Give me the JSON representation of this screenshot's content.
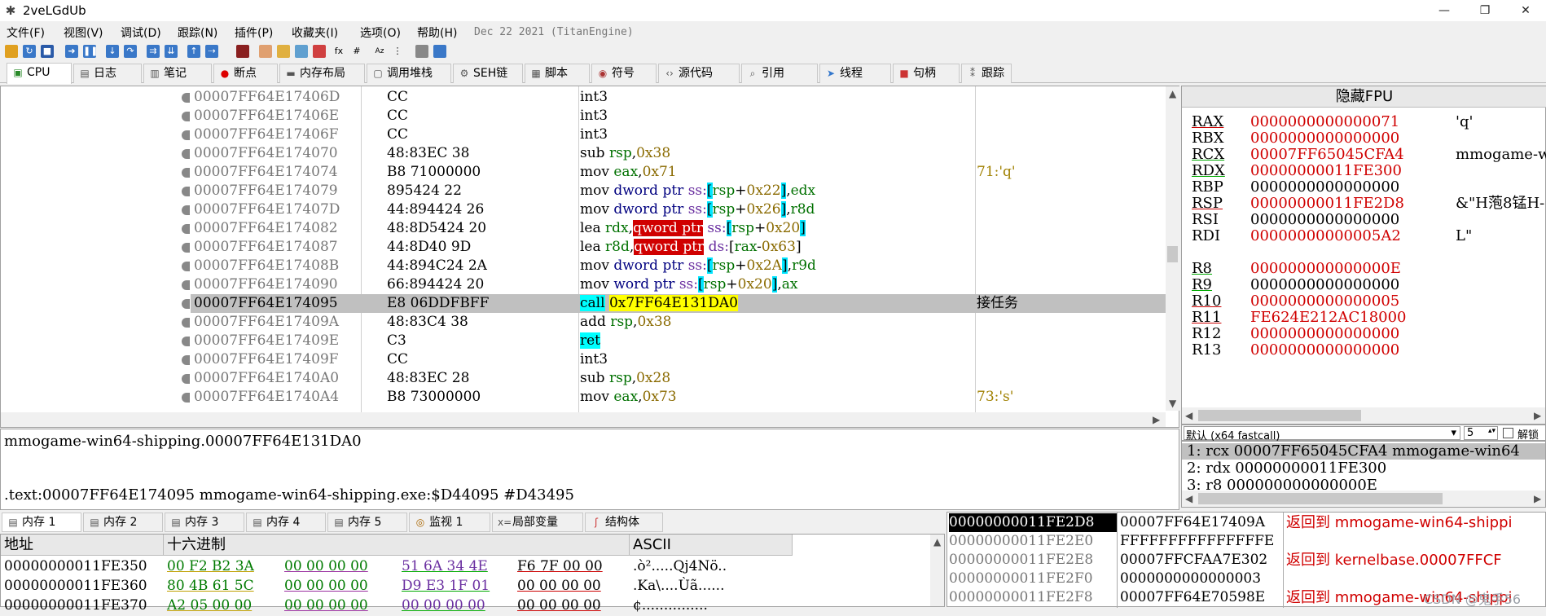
{
  "window": {
    "title": "2veLGdUb",
    "minimize": "—",
    "restore": "❐",
    "close": "✕"
  },
  "menu": [
    "文件(F)",
    "视图(V)",
    "调试(D)",
    "跟踪(N)",
    "插件(P)",
    "收藏夹(I)",
    "选项(O)",
    "帮助(H)"
  ],
  "build_date": "Dec 22 2021 (TitanEngine)",
  "tabs": [
    "CPU",
    "日志",
    "笔记",
    "断点",
    "内存布局",
    "调用堆栈",
    "SEH链",
    "脚本",
    "符号",
    "源代码",
    "引用",
    "线程",
    "句柄",
    "跟踪"
  ],
  "tab_icons": [
    "cpu-icon",
    "log-icon",
    "notes-icon",
    "breakpoint-icon",
    "memory-map-icon",
    "call-stack-icon",
    "seh-icon",
    "script-icon",
    "symbols-icon",
    "source-icon",
    "references-icon",
    "threads-icon",
    "handles-icon",
    "trace-icon"
  ],
  "disassembly": [
    {
      "addr": "00007FF64E17406D",
      "bytes": "CC",
      "asm": [
        [
          "mnem",
          "int3"
        ]
      ],
      "comment": ""
    },
    {
      "addr": "00007FF64E17406E",
      "bytes": "CC",
      "asm": [
        [
          "mnem",
          "int3"
        ]
      ],
      "comment": ""
    },
    {
      "addr": "00007FF64E17406F",
      "bytes": "CC",
      "asm": [
        [
          "mnem",
          "int3"
        ]
      ],
      "comment": ""
    },
    {
      "addr": "00007FF64E174070",
      "bytes": "48:83EC 38",
      "asm": [
        [
          "mnem",
          "sub "
        ],
        [
          "reg",
          "rsp"
        ],
        [
          "plain",
          ","
        ],
        [
          "num",
          "0x38"
        ]
      ],
      "comment": ""
    },
    {
      "addr": "00007FF64E174074",
      "bytes": "B8 71000000",
      "asm": [
        [
          "mnem",
          "mov "
        ],
        [
          "reg",
          "eax"
        ],
        [
          "plain",
          ","
        ],
        [
          "num",
          "0x71"
        ]
      ],
      "comment": "71:'q'"
    },
    {
      "addr": "00007FF64E174079",
      "bytes": "895424 22",
      "asm": [
        [
          "mnem",
          "mov "
        ],
        [
          "sz",
          "dword ptr "
        ],
        [
          "seg",
          "ss:"
        ],
        [
          "brk",
          "["
        ],
        [
          "reg",
          "rsp"
        ],
        [
          "plain",
          "+"
        ],
        [
          "num",
          "0x22"
        ],
        [
          "brk",
          "]"
        ],
        [
          "plain",
          ","
        ],
        [
          "reg",
          "edx"
        ]
      ],
      "comment": ""
    },
    {
      "addr": "00007FF64E17407D",
      "bytes": "44:894424 26",
      "asm": [
        [
          "mnem",
          "mov "
        ],
        [
          "sz",
          "dword ptr "
        ],
        [
          "seg",
          "ss:"
        ],
        [
          "brk",
          "["
        ],
        [
          "reg",
          "rsp"
        ],
        [
          "plain",
          "+"
        ],
        [
          "num",
          "0x26"
        ],
        [
          "brk",
          "]"
        ],
        [
          "plain",
          ","
        ],
        [
          "reg",
          "r8d"
        ]
      ],
      "comment": ""
    },
    {
      "addr": "00007FF64E174082",
      "bytes": "48:8D5424 20",
      "asm": [
        [
          "mnem",
          "lea "
        ],
        [
          "reg",
          "rdx"
        ],
        [
          "plain",
          ","
        ],
        [
          "ptrhl",
          "qword ptr"
        ],
        [
          "plain",
          " "
        ],
        [
          "seg",
          "ss:"
        ],
        [
          "brk",
          "["
        ],
        [
          "reg",
          "rsp"
        ],
        [
          "plain",
          "+"
        ],
        [
          "num",
          "0x20"
        ],
        [
          "brk",
          "]"
        ]
      ],
      "comment": ""
    },
    {
      "addr": "00007FF64E174087",
      "bytes": "44:8D40 9D",
      "asm": [
        [
          "mnem",
          "lea "
        ],
        [
          "reg",
          "r8d"
        ],
        [
          "plain",
          ","
        ],
        [
          "ptrhl",
          "qword ptr"
        ],
        [
          "plain",
          " "
        ],
        [
          "seg",
          "ds:"
        ],
        [
          "plain",
          "["
        ],
        [
          "reg",
          "rax"
        ],
        [
          "plain",
          "-"
        ],
        [
          "num",
          "0x63"
        ],
        [
          "plain",
          "]"
        ]
      ],
      "comment": ""
    },
    {
      "addr": "00007FF64E17408B",
      "bytes": "44:894C24 2A",
      "asm": [
        [
          "mnem",
          "mov "
        ],
        [
          "sz",
          "dword ptr "
        ],
        [
          "seg",
          "ss:"
        ],
        [
          "brk",
          "["
        ],
        [
          "reg",
          "rsp"
        ],
        [
          "plain",
          "+"
        ],
        [
          "num",
          "0x2A"
        ],
        [
          "brk",
          "]"
        ],
        [
          "plain",
          ","
        ],
        [
          "reg",
          "r9d"
        ]
      ],
      "comment": ""
    },
    {
      "addr": "00007FF64E174090",
      "bytes": "66:894424 20",
      "asm": [
        [
          "mnem",
          "mov "
        ],
        [
          "sz",
          "word ptr "
        ],
        [
          "seg",
          "ss:"
        ],
        [
          "brk",
          "["
        ],
        [
          "reg",
          "rsp"
        ],
        [
          "plain",
          "+"
        ],
        [
          "num",
          "0x20"
        ],
        [
          "brk",
          "]"
        ],
        [
          "plain",
          ","
        ],
        [
          "reg",
          "ax"
        ]
      ],
      "comment": ""
    },
    {
      "addr": "00007FF64E174095",
      "bytes": "E8 06DDFBFF",
      "asm": [
        [
          "callhl",
          "call"
        ],
        [
          "plain",
          " "
        ],
        [
          "targ",
          "0x7FF64E131DA0"
        ]
      ],
      "comment": "接任务",
      "selected": true
    },
    {
      "addr": "00007FF64E17409A",
      "bytes": "48:83C4 38",
      "asm": [
        [
          "mnem",
          "add "
        ],
        [
          "reg",
          "rsp"
        ],
        [
          "plain",
          ","
        ],
        [
          "num",
          "0x38"
        ]
      ],
      "comment": ""
    },
    {
      "addr": "00007FF64E17409E",
      "bytes": "C3",
      "asm": [
        [
          "callhl",
          "ret"
        ]
      ],
      "comment": ""
    },
    {
      "addr": "00007FF64E17409F",
      "bytes": "CC",
      "asm": [
        [
          "mnem",
          "int3"
        ]
      ],
      "comment": ""
    },
    {
      "addr": "00007FF64E1740A0",
      "bytes": "48:83EC 28",
      "asm": [
        [
          "mnem",
          "sub "
        ],
        [
          "reg",
          "rsp"
        ],
        [
          "plain",
          ","
        ],
        [
          "num",
          "0x28"
        ]
      ],
      "comment": ""
    },
    {
      "addr": "00007FF64E1740A4",
      "bytes": "B8 73000000",
      "asm": [
        [
          "mnem",
          "mov "
        ],
        [
          "reg",
          "eax"
        ],
        [
          "plain",
          ","
        ],
        [
          "num",
          "0x73"
        ]
      ],
      "comment": "73:'s'"
    }
  ],
  "info": {
    "line1": "mmogame-win64-shipping.00007FF64E131DA0",
    "line2": ".text:00007FF64E174095 mmogame-win64-shipping.exe:$D44095 #D43495"
  },
  "registers": {
    "header": "隐藏FPU",
    "rows": [
      {
        "name": "RAX",
        "value": "0000000000000071",
        "comment": "'q'",
        "red": true,
        "ul": "red"
      },
      {
        "name": "RBX",
        "value": "0000000000000000",
        "comment": "",
        "red": true,
        "ul": ""
      },
      {
        "name": "RCX",
        "value": "00007FF65045CFA4",
        "comment": "mmogame-w",
        "red": true,
        "ul": "green"
      },
      {
        "name": "RDX",
        "value": "00000000011FE300",
        "comment": "",
        "red": true,
        "ul": "green"
      },
      {
        "name": "RBP",
        "value": "0000000000000000",
        "comment": "",
        "red": false,
        "ul": ""
      },
      {
        "name": "RSP",
        "value": "00000000011FE2D8",
        "comment": "&\"H萢8锰H-",
        "red": true,
        "ul": "red"
      },
      {
        "name": "RSI",
        "value": "0000000000000000",
        "comment": "",
        "red": false,
        "ul": ""
      },
      {
        "name": "RDI",
        "value": "00000000000005A2",
        "comment": "L\"",
        "red": true,
        "ul": ""
      },
      {
        "name": "",
        "value": "",
        "comment": "",
        "red": false,
        "ul": ""
      },
      {
        "name": "R8",
        "value": "000000000000000E",
        "comment": "",
        "red": true,
        "ul": "green"
      },
      {
        "name": "R9",
        "value": "0000000000000000",
        "comment": "",
        "red": false,
        "ul": "green"
      },
      {
        "name": "R10",
        "value": "0000000000000005",
        "comment": "",
        "red": true,
        "ul": "red"
      },
      {
        "name": "R11",
        "value": "FE624E212AC18000",
        "comment": "",
        "red": true,
        "ul": "red"
      },
      {
        "name": "R12",
        "value": "0000000000000000",
        "comment": "",
        "red": true,
        "ul": ""
      },
      {
        "name": "R13",
        "value": "0000000000000000",
        "comment": "",
        "red": true,
        "ul": ""
      }
    ]
  },
  "callconv": {
    "select": "默认 (x64 fastcall)",
    "arg_count": "5",
    "unlock_label": "解锁",
    "lines": [
      "1: rcx 00007FF65045CFA4 mmogame-win64",
      "2: rdx 00000000011FE300",
      "3: r8 000000000000000E"
    ]
  },
  "mem_tabs": [
    "内存 1",
    "内存 2",
    "内存 3",
    "内存 4",
    "内存 5",
    "监视 1",
    "局部变量",
    "结构体"
  ],
  "mem_tab_icons": [
    "memory-icon",
    "memory-icon",
    "memory-icon",
    "memory-icon",
    "memory-icon",
    "watch-icon",
    "locals-icon",
    "struct-icon"
  ],
  "dump": {
    "col_addr": "地址",
    "col_hex": "十六进制",
    "col_ascii": "ASCII",
    "rows": [
      {
        "addr": "00000000011FE350",
        "hex": [
          "00 F2 B2 3A",
          "00 00 00 00",
          "51 6A 34 4E",
          "F6 7F 00 00"
        ],
        "ascii": ".ò².....Qj4Nö.."
      },
      {
        "addr": "00000000011FE360",
        "hex": [
          "80 4B 61 5C",
          "00 00 00 00",
          "D9 E3 1F 01",
          "00 00 00 00"
        ],
        "ascii": ".Ka\\....Ùã......"
      },
      {
        "addr": "00000000011FE370",
        "hex": [
          "A2 05 00 00",
          "00 00 00 00",
          "00 00 00 00",
          "00 00 00 00"
        ],
        "ascii": "¢..............."
      }
    ]
  },
  "stack": {
    "rows": [
      {
        "addr": "00000000011FE2D8",
        "value": "00007FF64E17409A",
        "comment": "返回到 mmogame-win64-shippi",
        "top": true
      },
      {
        "addr": "00000000011FE2E0",
        "value": "FFFFFFFFFFFFFFFE",
        "comment": "",
        "top": false
      },
      {
        "addr": "00000000011FE2E8",
        "value": "00007FFCFAA7E302",
        "comment": "返回到 kernelbase.00007FFCF",
        "top": false
      },
      {
        "addr": "00000000011FE2F0",
        "value": "0000000000000003",
        "comment": "",
        "top": false
      },
      {
        "addr": "00000000011FE2F8",
        "value": "00007FF64E70598E",
        "comment": "返回到 mmogame-win64-shippi",
        "top": false
      }
    ]
  },
  "watermark": "CSDN @鬼手56"
}
